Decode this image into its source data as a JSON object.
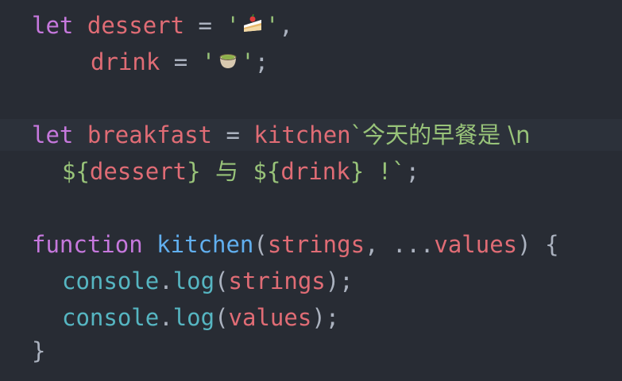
{
  "code": {
    "line1": {
      "kw": "let",
      "name": "dessert",
      "eq": "=",
      "q1": "'",
      "emoji_name": "cake-emoji",
      "q2": "'",
      "comma": ","
    },
    "line2": {
      "name": "drink",
      "eq": "=",
      "q1": "'",
      "emoji_name": "tea-emoji",
      "q2": "'",
      "semi": ";"
    },
    "line3": {
      "kw": "let",
      "name": "breakfast",
      "eq": "=",
      "tag": "kitchen",
      "tpl": "`今天的早餐是 \\n"
    },
    "line4": {
      "open1": "${",
      "var1": "dessert",
      "close1": "}",
      "mid": "  与  ",
      "open2": "${",
      "var2": "drink",
      "close2": "}",
      "end": " !`",
      "semi": ";"
    },
    "line5": {
      "kw": "function",
      "fn": "kitchen",
      "lparen": "(",
      "p1": "strings",
      "sep": ", ",
      "spread": "...",
      "p2": "values",
      "rparen": ")",
      "brace": " {"
    },
    "line6": {
      "obj": "console",
      "dot": ".",
      "method": "log",
      "lparen": "(",
      "arg": "strings",
      "rparen": ")",
      "semi": ";"
    },
    "line7": {
      "obj": "console",
      "dot": ".",
      "method": "log",
      "lparen": "(",
      "arg": "values",
      "rparen": ")",
      "semi": ";"
    },
    "line8": {
      "brace": "}"
    }
  },
  "colors": {
    "background": "#282c34",
    "keyword": "#c678dd",
    "variable": "#e06c75",
    "string": "#98c379",
    "function": "#61afef",
    "object": "#56b6c2",
    "punctuation": "#abb2bf"
  }
}
